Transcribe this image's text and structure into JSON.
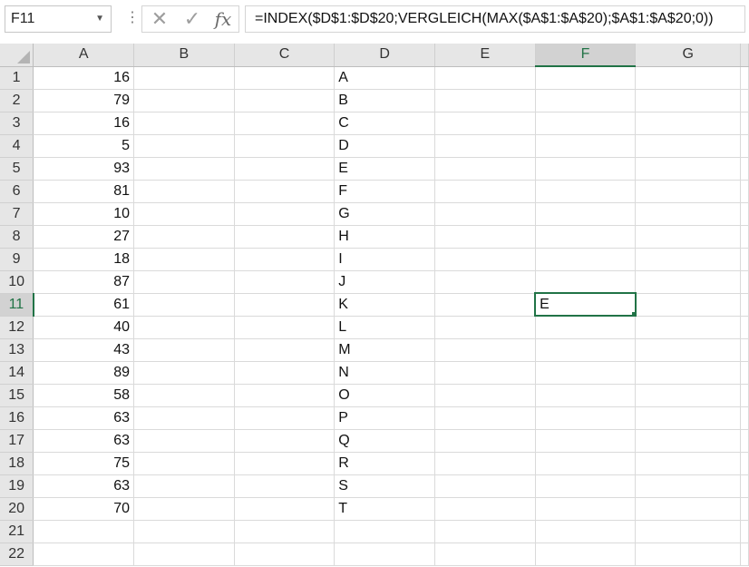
{
  "formula_bar": {
    "name_box": "F11",
    "formula": "=INDEX($D$1:$D$20;VERGLEICH(MAX($A$1:$A$20);$A$1:$A$20;0))"
  },
  "columns": [
    "A",
    "B",
    "C",
    "D",
    "E",
    "F",
    "G"
  ],
  "rows": [
    {
      "n": "1",
      "A": "16",
      "D": "A"
    },
    {
      "n": "2",
      "A": "79",
      "D": "B"
    },
    {
      "n": "3",
      "A": "16",
      "D": "C"
    },
    {
      "n": "4",
      "A": "5",
      "D": "D"
    },
    {
      "n": "5",
      "A": "93",
      "D": "E"
    },
    {
      "n": "6",
      "A": "81",
      "D": "F"
    },
    {
      "n": "7",
      "A": "10",
      "D": "G"
    },
    {
      "n": "8",
      "A": "27",
      "D": "H"
    },
    {
      "n": "9",
      "A": "18",
      "D": "I"
    },
    {
      "n": "10",
      "A": "87",
      "D": "J"
    },
    {
      "n": "11",
      "A": "61",
      "D": "K",
      "F": "E"
    },
    {
      "n": "12",
      "A": "40",
      "D": "L"
    },
    {
      "n": "13",
      "A": "43",
      "D": "M"
    },
    {
      "n": "14",
      "A": "89",
      "D": "N"
    },
    {
      "n": "15",
      "A": "58",
      "D": "O"
    },
    {
      "n": "16",
      "A": "63",
      "D": "P"
    },
    {
      "n": "17",
      "A": "63",
      "D": "Q"
    },
    {
      "n": "18",
      "A": "75",
      "D": "R"
    },
    {
      "n": "19",
      "A": "63",
      "D": "S"
    },
    {
      "n": "20",
      "A": "70",
      "D": "T"
    },
    {
      "n": "21"
    },
    {
      "n": "22"
    }
  ],
  "selection": {
    "column": "F",
    "row": "11"
  },
  "colors": {
    "accent": "#217346",
    "header_bg": "#e6e6e6",
    "gridline": "#dadada"
  }
}
